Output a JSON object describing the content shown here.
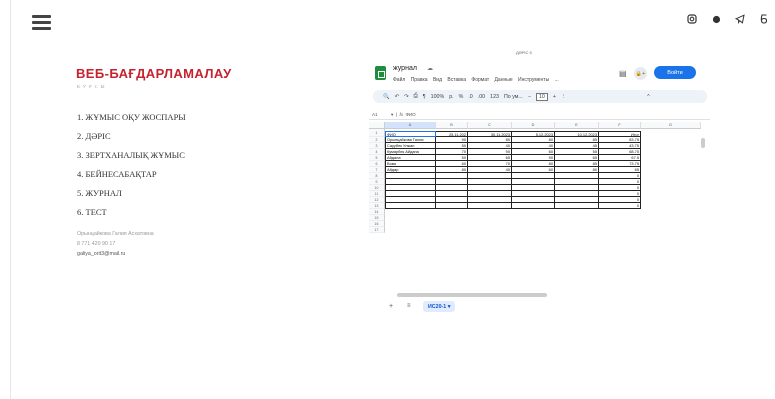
{
  "site": {
    "title": "ВЕБ-БАҒДАРЛАМАЛАУ",
    "subtitle": "КУРСЫ",
    "menu": [
      "1. ЖҰМЫС ОҚУ ЖОСПАРЫ",
      "2. ДӘРІС",
      "3. ЗЕРТХАНАЛЫҚ ЖҰМЫС",
      "4. БЕЙНЕСАБАҚТАР",
      "5. ЖУРНАЛ",
      "6. ТЕСТ"
    ],
    "contact": {
      "name": "Орынцайкова Галия Асхатовна",
      "phone": "8 771 420 90 17",
      "email": "galiya_orit3@mail.ru"
    },
    "top_icons": [
      "instagram-icon",
      "circle-icon",
      "telegram-icon",
      "letter-icon"
    ],
    "accent_color": "#c4232f"
  },
  "sheet": {
    "caption": "ДӘРІС 5",
    "doc_name": "журнал",
    "menubar": [
      "Файл",
      "Правка",
      "Вид",
      "Вставка",
      "Формат",
      "Данные",
      "Инструменты",
      "..."
    ],
    "signin_label": "Войти",
    "share_label": "🔒+",
    "toolbar": {
      "zoom": "100%",
      "currency": "р.",
      "percent": "%",
      "dec_less": ".0",
      "dec_more": ".00",
      "num_fmt": "123",
      "font": "По ум...",
      "font_size": "10"
    },
    "cell_ref": "A1",
    "formula": "ФИО",
    "columns": [
      "A",
      "B",
      "C",
      "D",
      "E",
      "F",
      "G"
    ],
    "row_numbers": [
      "1",
      "2",
      "3",
      "4",
      "5",
      "6",
      "7",
      "8",
      "9",
      "10",
      "11",
      "12",
      "13",
      "14",
      "15",
      "16",
      "17"
    ],
    "header_row": [
      "ФИО",
      "25.11.202",
      "30.11.2023",
      "5.12.2023",
      "10.12.2023",
      "Итог"
    ],
    "rows": [
      [
        "Орынцайкова Галия",
        "90",
        "80",
        "80",
        "85",
        "83.75"
      ],
      [
        "Сауубек Улжан",
        "50",
        "40",
        "40",
        "45",
        "43.75"
      ],
      [
        "Кумарбек Айдана",
        "70",
        "90",
        "60",
        "55",
        "68.75"
      ],
      [
        "Айдана",
        "50",
        "65",
        "90",
        "65",
        "67.5"
      ],
      [
        "Вова",
        "60",
        "70",
        "80",
        "85",
        "73.75"
      ],
      [
        "Айдар",
        "80",
        "40",
        "60",
        "80",
        "65"
      ],
      [
        "",
        "",
        "",
        "",
        "",
        "0"
      ],
      [
        "",
        "",
        "",
        "",
        "",
        "0"
      ],
      [
        "",
        "",
        "",
        "",
        "",
        "0"
      ],
      [
        "",
        "",
        "",
        "",
        "",
        "0"
      ],
      [
        "",
        "",
        "",
        "",
        "",
        "0"
      ],
      [
        "",
        "",
        "",
        "",
        "",
        "0"
      ]
    ],
    "tab_name": "ИС20-1",
    "tab_arrow": "▾"
  }
}
